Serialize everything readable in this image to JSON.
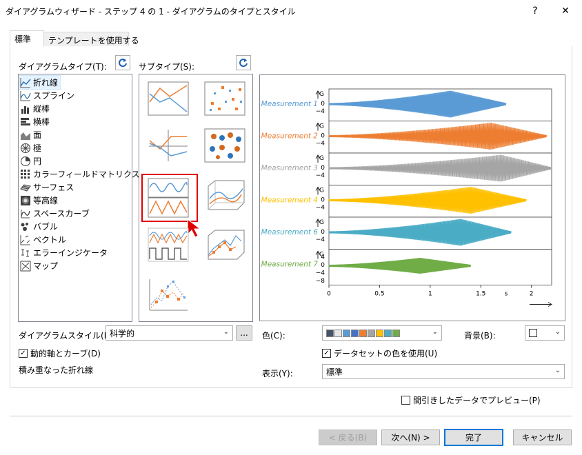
{
  "window": {
    "title": "ダイアグラムウィザード - ステップ 4 の 1 - ダイアグラムのタイプとスタイル",
    "help": "?",
    "close": "✕"
  },
  "tabs": [
    {
      "label": "標準",
      "active": true
    },
    {
      "label": "テンプレートを使用する",
      "active": false
    }
  ],
  "diagram_type": {
    "label": "ダイアグラムタイプ(T):",
    "items": [
      {
        "label": "折れ線",
        "icon": "line-chart-icon",
        "selected": true
      },
      {
        "label": "スプライン",
        "icon": "spline-chart-icon"
      },
      {
        "label": "縦棒",
        "icon": "column-chart-icon"
      },
      {
        "label": "横棒",
        "icon": "bar-chart-icon"
      },
      {
        "label": "面",
        "icon": "area-chart-icon"
      },
      {
        "label": "極",
        "icon": "polar-chart-icon"
      },
      {
        "label": "円",
        "icon": "pie-chart-icon"
      },
      {
        "label": "カラーフィールドマトリクス",
        "icon": "color-matrix-icon"
      },
      {
        "label": "サーフェス",
        "icon": "surface-chart-icon"
      },
      {
        "label": "等高線",
        "icon": "contour-chart-icon"
      },
      {
        "label": "スペースカーブ",
        "icon": "space-curve-icon"
      },
      {
        "label": "バブル",
        "icon": "bubble-chart-icon"
      },
      {
        "label": "ベクトル",
        "icon": "vector-chart-icon"
      },
      {
        "label": "エラーインジケータ",
        "icon": "error-indicator-icon"
      },
      {
        "label": "マップ",
        "icon": "map-icon"
      }
    ]
  },
  "subtype": {
    "label": "サブタイプ(S):",
    "selected_index": 4
  },
  "preview": {
    "series": [
      {
        "name": "Measurement 1",
        "color": "#5b9bd5",
        "end": 1.75,
        "peak": 1.2
      },
      {
        "name": "Measurement 2",
        "color": "#ed7d31",
        "end": 2.15,
        "peak": 1.6
      },
      {
        "name": "Measurement 3",
        "color": "#a5a5a5",
        "end": 2.2,
        "peak": 1.7
      },
      {
        "name": "Measurement 4",
        "color": "#ffc000",
        "end": 1.95,
        "peak": 1.4
      },
      {
        "name": "Measurement 6",
        "color": "#4bacc6",
        "end": 1.8,
        "peak": 1.3
      },
      {
        "name": "Measurement 7",
        "color": "#70ad47",
        "end": 1.4,
        "peak": 0.9
      }
    ],
    "y_axis_letter": "G",
    "y_ticks": [
      "0",
      "−4"
    ],
    "y_ticks_last": [
      "4",
      "0",
      "−4",
      "−8"
    ],
    "x_ticks": [
      "0",
      "0.5",
      "1",
      "1.5",
      "2"
    ],
    "x_unit": "s"
  },
  "bottom_left": {
    "style_label": "ダイアグラムスタイル(M):",
    "style_value": "科学的",
    "more_button": "...",
    "dynamic_axes": "動的軸とカーブ(D)",
    "dynamic_axes_checked": true,
    "description": "積み重なった折れ線"
  },
  "bottom_right": {
    "color_label": "色(C):",
    "palette": [
      "#44546a",
      "#e7e6e6",
      "#5b9bd5",
      "#4472c4",
      "#ed7d31",
      "#a5a5a5",
      "#ffc000",
      "#4bacc6",
      "#70ad47"
    ],
    "background_label": "背景(B):",
    "use_dataset_color": "データセットの色を使用(U)",
    "use_dataset_color_checked": true,
    "display_label": "表示(Y):",
    "display_value": "標準"
  },
  "preview_thinned": {
    "label": "間引きしたデータでプレビュー(P)",
    "checked": false
  },
  "buttons": {
    "back": "< 戻る(B)",
    "next": "次へ(N) >",
    "finish": "完了",
    "cancel": "キャンセル"
  }
}
